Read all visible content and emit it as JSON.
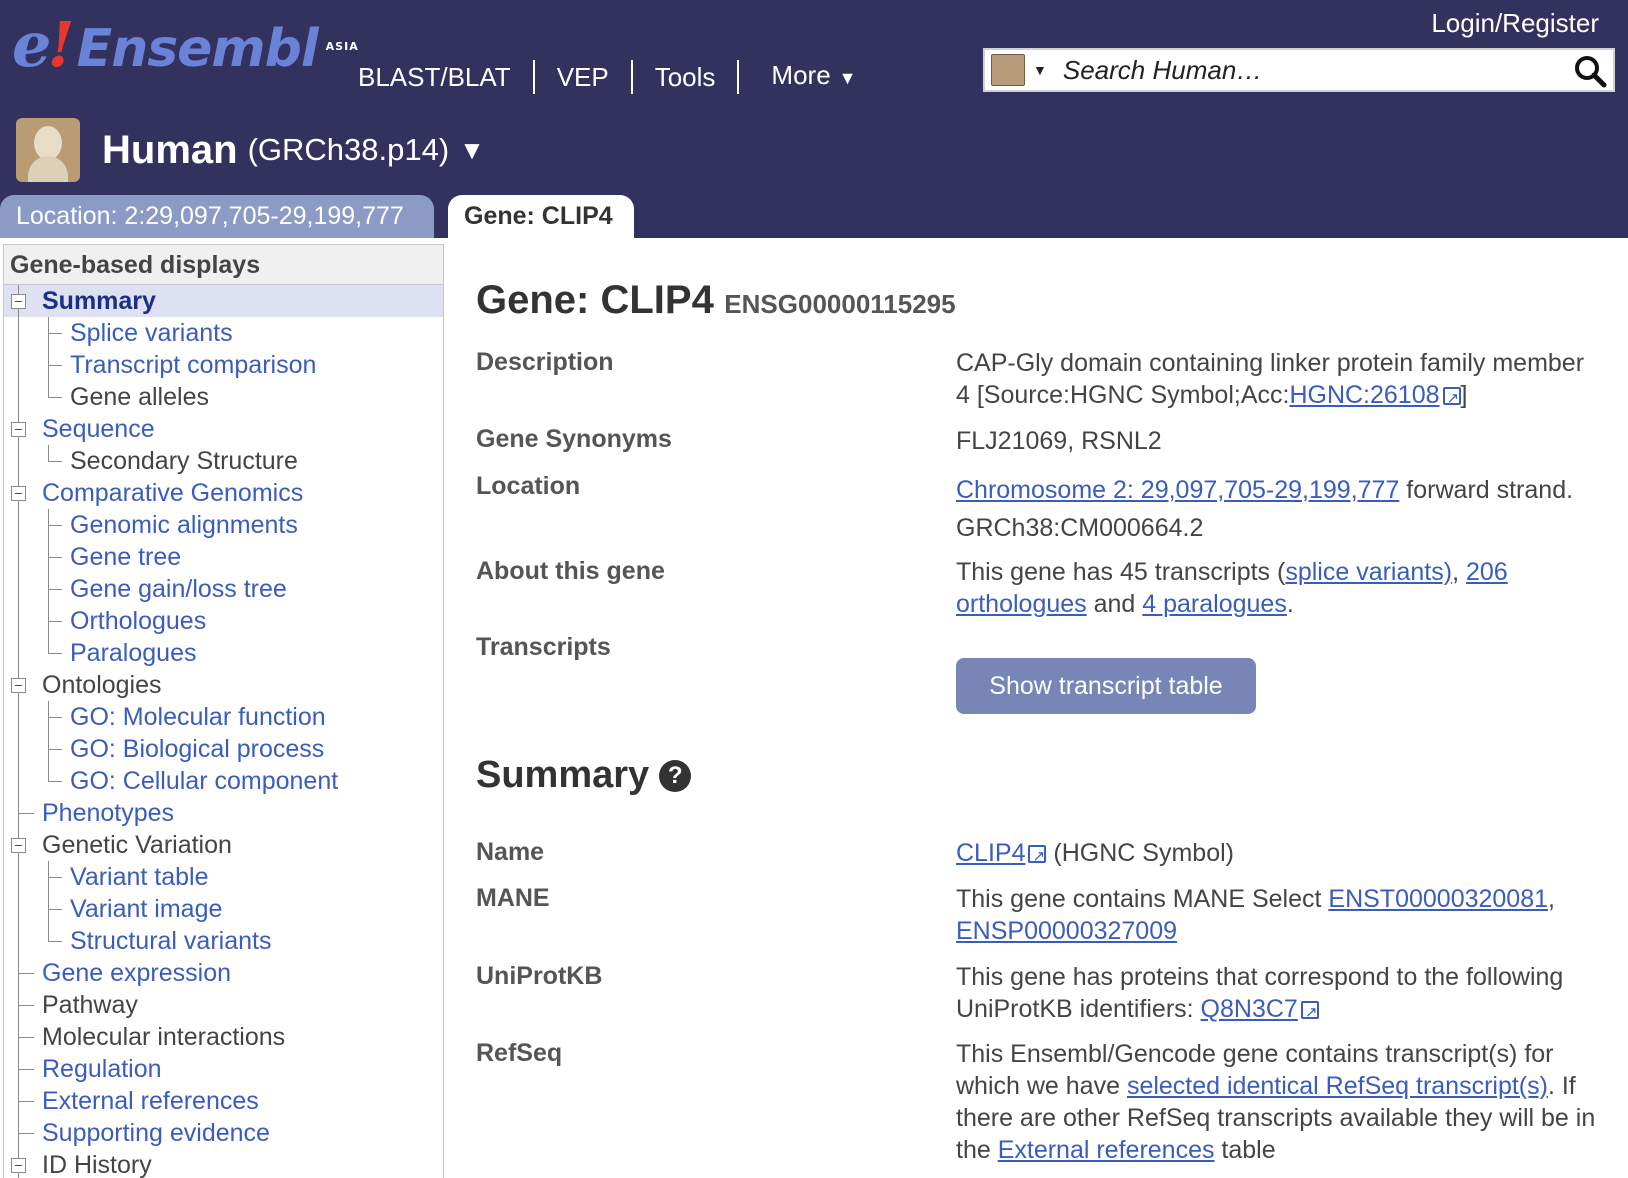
{
  "masthead": {
    "logo_text": "Ensembl",
    "logo_region": "ASIA",
    "nav": [
      "BLAST/BLAT",
      "VEP",
      "Tools",
      "More"
    ],
    "login": "Login/Register",
    "search_placeholder": "Search Human…"
  },
  "species": {
    "name": "Human",
    "assembly": "(GRCh38.p14)"
  },
  "tabs": {
    "location": "Location: 2:29,097,705-29,199,777",
    "gene": "Gene: CLIP4"
  },
  "leftnav": {
    "header": "Gene-based displays",
    "items": [
      {
        "label": "Summary",
        "level": 0,
        "link": true,
        "selected": true,
        "toggle": true
      },
      {
        "label": "Splice variants",
        "level": 1,
        "link": true
      },
      {
        "label": "Transcript comparison",
        "level": 1,
        "link": true
      },
      {
        "label": "Gene alleles",
        "level": 1,
        "link": false
      },
      {
        "label": "Sequence",
        "level": 0,
        "link": true,
        "toggle": true
      },
      {
        "label": "Secondary Structure",
        "level": 1,
        "link": false
      },
      {
        "label": "Comparative Genomics",
        "level": 0,
        "link": true,
        "toggle": true
      },
      {
        "label": "Genomic alignments",
        "level": 1,
        "link": true
      },
      {
        "label": "Gene tree",
        "level": 1,
        "link": true
      },
      {
        "label": "Gene gain/loss tree",
        "level": 1,
        "link": true
      },
      {
        "label": "Orthologues",
        "level": 1,
        "link": true
      },
      {
        "label": "Paralogues",
        "level": 1,
        "link": true
      },
      {
        "label": "Ontologies",
        "level": 0,
        "link": false,
        "toggle": true
      },
      {
        "label": "GO: Molecular function",
        "level": 1,
        "link": true
      },
      {
        "label": "GO: Biological process",
        "level": 1,
        "link": true
      },
      {
        "label": "GO: Cellular component",
        "level": 1,
        "link": true
      },
      {
        "label": "Phenotypes",
        "level": 0,
        "link": true
      },
      {
        "label": "Genetic Variation",
        "level": 0,
        "link": false,
        "toggle": true
      },
      {
        "label": "Variant table",
        "level": 1,
        "link": true
      },
      {
        "label": "Variant image",
        "level": 1,
        "link": true
      },
      {
        "label": "Structural variants",
        "level": 1,
        "link": true
      },
      {
        "label": "Gene expression",
        "level": 0,
        "link": true
      },
      {
        "label": "Pathway",
        "level": 0,
        "link": false
      },
      {
        "label": "Molecular interactions",
        "level": 0,
        "link": false
      },
      {
        "label": "Regulation",
        "level": 0,
        "link": true
      },
      {
        "label": "External references",
        "level": 0,
        "link": true
      },
      {
        "label": "Supporting evidence",
        "level": 0,
        "link": true
      },
      {
        "label": "ID History",
        "level": 0,
        "link": false,
        "toggle": true
      }
    ]
  },
  "gene": {
    "title": "Gene: CLIP4",
    "stable_id": "ENSG00000115295",
    "description_label": "Description",
    "description_text": "CAP-Gly domain containing linker protein family member 4 [Source:HGNC Symbol;Acc:",
    "description_link": "HGNC:26108",
    "description_close": "]",
    "synonyms_label": "Gene Synonyms",
    "synonyms": "FLJ21069, RSNL2",
    "location_label": "Location",
    "location_link": "Chromosome 2: 29,097,705-29,199,777",
    "location_strand": " forward strand.",
    "location_assembly": "GRCh38:CM000664.2",
    "about_label": "About this gene",
    "about_prefix": "This gene has 45 transcripts (",
    "about_splice": "splice variants)",
    "about_comma": ", ",
    "about_orth": "206 orthologues",
    "about_and": " and ",
    "about_para": "4 paralogues",
    "about_end": ".",
    "transcripts_label": "Transcripts",
    "show_transcripts": "Show transcript table"
  },
  "summary": {
    "heading": "Summary",
    "help": "?",
    "name_label": "Name",
    "name_link": "CLIP4",
    "name_suffix": " (HGNC Symbol)",
    "mane_label": "MANE",
    "mane_prefix": "This gene contains MANE Select ",
    "mane_transcript": "ENST00000320081",
    "mane_comma": ",",
    "mane_protein": "ENSP00000327009",
    "uniprot_label": "UniProtKB",
    "uniprot_text": "This gene has proteins that correspond to the following UniProtKB identifiers: ",
    "uniprot_link": "Q8N3C7",
    "refseq_label": "RefSeq",
    "refseq_text1": "This Ensembl/Gencode gene contains transcript(s) for which we have ",
    "refseq_link1": "selected identical RefSeq transcript(s)",
    "refseq_text2": ". If there are other RefSeq transcripts available they will be in the ",
    "refseq_link2": "External references",
    "refseq_text3": " table"
  },
  "colors": {
    "masthead": "#33325e",
    "link": "#3a5dbd",
    "tab_inactive": "#8c9bc6",
    "button": "#7786b6",
    "selected_nav": "#dee1f1"
  }
}
